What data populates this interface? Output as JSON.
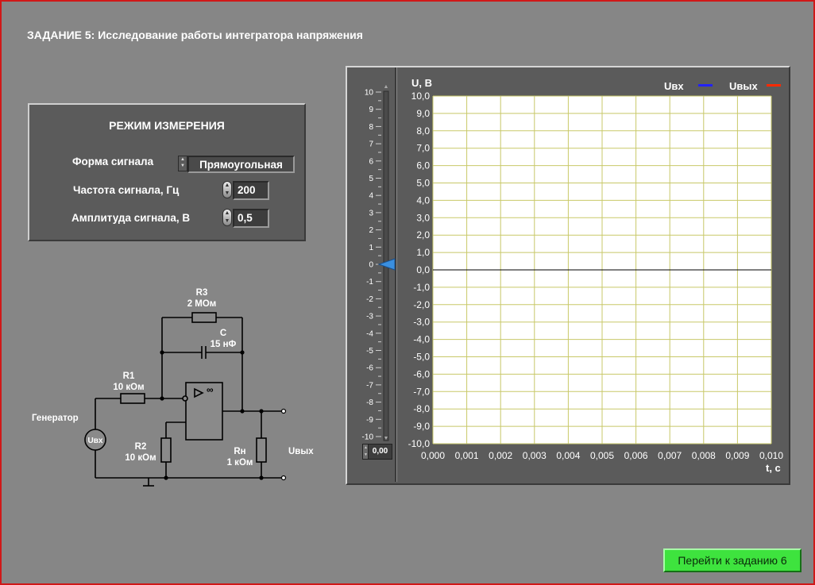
{
  "task_title": "ЗАДАНИЕ 5: Исследование работы интегратора напряжения",
  "mode_panel": {
    "title": "РЕЖИМ ИЗМЕРЕНИЯ",
    "signal_form_label": "Форма сигнала",
    "signal_form_value": "Прямоугольная",
    "frequency_label": "Частота сигнала, Гц",
    "frequency_value": "200",
    "amplitude_label": "Амплитуда сигнала, В",
    "amplitude_value": "0,5"
  },
  "circuit": {
    "r3": "R3",
    "r3_value": "2 МОм",
    "c": "С",
    "c_value": "15 нФ",
    "r1": "R1",
    "r1_value": "10 кОм",
    "r2": "R2",
    "r2_value": "10 кОм",
    "rn": "Rн",
    "rn_value": "1 кОм",
    "generator": "Генератор",
    "uin": "Uвх",
    "uout": "Uвых"
  },
  "chart_data": {
    "type": "line",
    "ylabel": "U, В",
    "xlabel": "t, с",
    "xlim": [
      0,
      0.01
    ],
    "ylim": [
      -10,
      10
    ],
    "x_ticks": [
      "0,000",
      "0,001",
      "0,002",
      "0,003",
      "0,004",
      "0,005",
      "0,006",
      "0,007",
      "0,008",
      "0,009",
      "0,010"
    ],
    "y_ticks": [
      "10,0",
      "9,0",
      "8,0",
      "7,0",
      "6,0",
      "5,0",
      "4,0",
      "3,0",
      "2,0",
      "1,0",
      "0,0",
      "-1,0",
      "-2,0",
      "-3,0",
      "-4,0",
      "-5,0",
      "-6,0",
      "-7,0",
      "-8,0",
      "-9,0",
      "-10,0"
    ],
    "grid": true,
    "legend_position": "top-right",
    "series": [
      {
        "name": "Uвх",
        "color": "#2222ff",
        "points": []
      },
      {
        "name": "Uвых",
        "color": "#ff2a00",
        "points": []
      }
    ],
    "grid_color": "#c8c868",
    "plot_background": "#ffffff"
  },
  "slider": {
    "ticks": [
      "10",
      "9",
      "8",
      "7",
      "6",
      "5",
      "4",
      "3",
      "2",
      "1",
      "0",
      "-1",
      "-2",
      "-3",
      "-4",
      "-5",
      "-6",
      "-7",
      "-8",
      "-9",
      "-10"
    ],
    "value": 0,
    "value_display": "0,00",
    "pointer_color": "#3a8fe0"
  },
  "next_button": {
    "label": "Перейти к заданию 6"
  },
  "colors": {
    "frame_border": "#d01818",
    "background": "#868686",
    "button": "#3ee33e"
  }
}
